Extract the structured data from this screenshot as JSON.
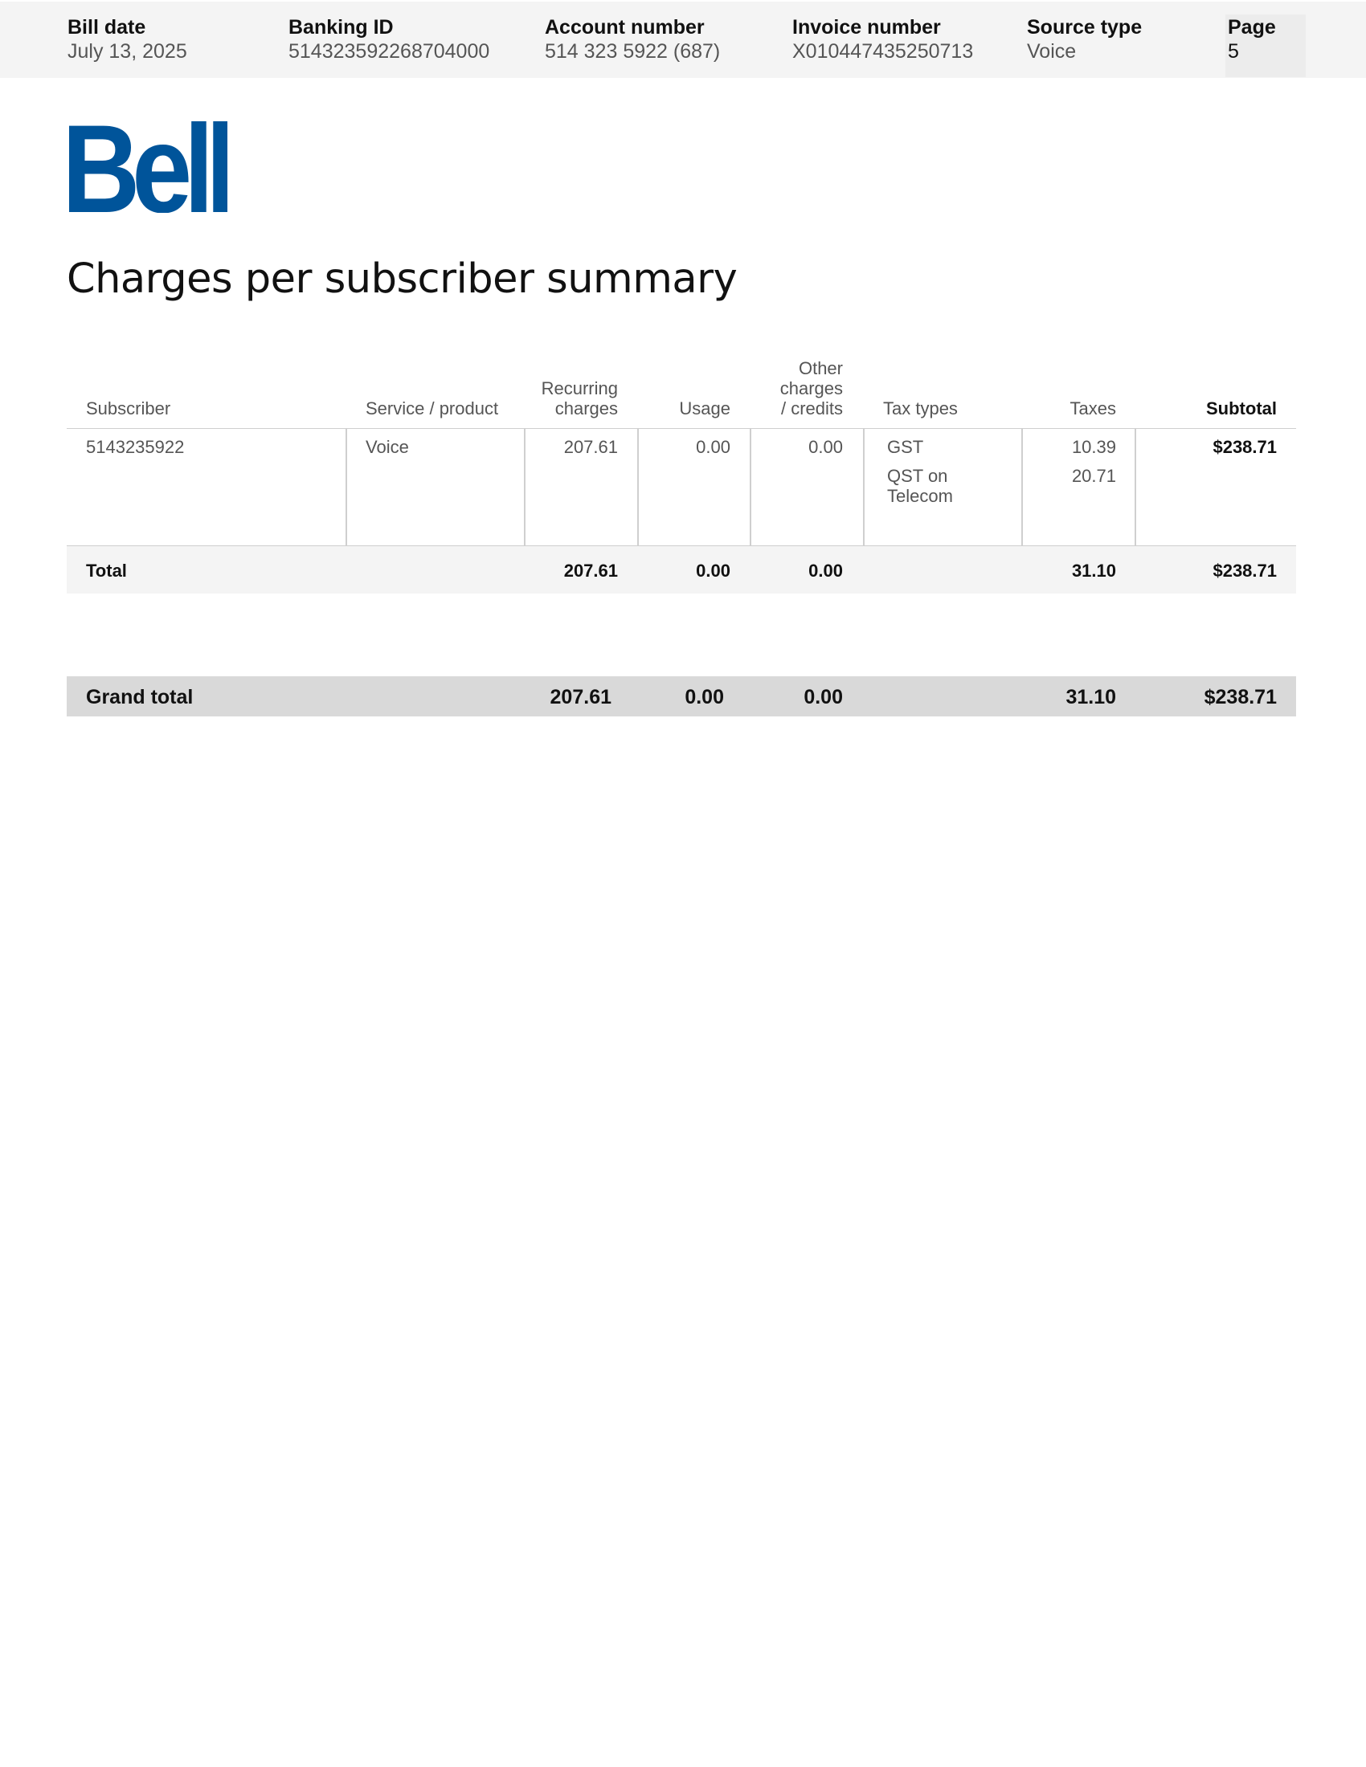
{
  "header": {
    "bill_date_label": "Bill date",
    "bill_date": "July 13, 2025",
    "banking_id_label": "Banking ID",
    "banking_id": "514323592268704000",
    "account_number_label": "Account number",
    "account_number": "514 323 5922  (687)",
    "invoice_number_label": "Invoice number",
    "invoice_number": "X010447435250713",
    "source_type_label": "Source type",
    "source_type": "Voice",
    "page_label": "Page",
    "page": "5"
  },
  "brand": {
    "logo_text": "Bell",
    "color": "#00549a"
  },
  "title": "Charges per subscriber summary",
  "table": {
    "columns": {
      "subscriber": "Subscriber",
      "service": "Service / product",
      "recurring": [
        "Recurring",
        "charges"
      ],
      "usage": "Usage",
      "other": [
        "Other",
        "charges",
        "/ credits"
      ],
      "tax_types": "Tax types",
      "taxes": "Taxes",
      "subtotal": "Subtotal"
    },
    "rows": [
      {
        "subscriber": "5143235922",
        "service": "Voice",
        "recurring": "207.61",
        "usage": "0.00",
        "other": "0.00",
        "tax_types": [
          "GST",
          "QST on",
          "Telecom"
        ],
        "taxes": [
          "10.39",
          "20.71"
        ],
        "subtotal": "$238.71"
      }
    ],
    "total": {
      "label": "Total",
      "recurring": "207.61",
      "usage": "0.00",
      "other": "0.00",
      "taxes": "31.10",
      "subtotal": "$238.71"
    },
    "grand_total": {
      "label": "Grand total",
      "recurring": "207.61",
      "usage": "0.00",
      "other": "0.00",
      "taxes": "31.10",
      "subtotal": "$238.71"
    }
  }
}
